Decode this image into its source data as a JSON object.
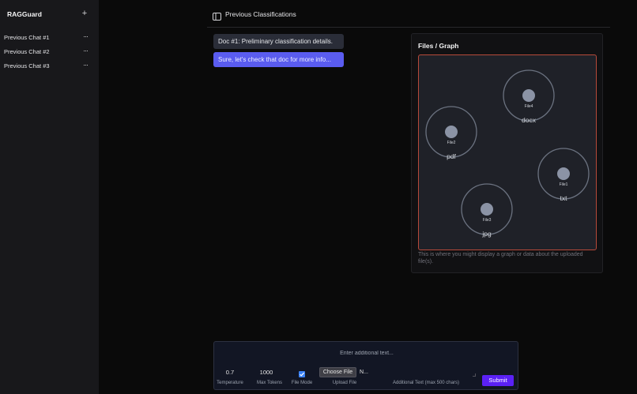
{
  "sidebar": {
    "brand": "RAGGuard",
    "new_chat_label": "+",
    "chats": [
      {
        "label": "Previous Chat #1",
        "menu": "···"
      },
      {
        "label": "Previous Chat #2",
        "menu": "···"
      },
      {
        "label": "Previous Chat #3",
        "menu": "···"
      }
    ]
  },
  "header": {
    "title": "Previous Classifications",
    "icon": "sidebar-panel-icon"
  },
  "messages": [
    {
      "text": "Doc #1: Preliminary classification details."
    },
    {
      "text": "Sure, let's check that doc for more info..."
    }
  ],
  "files_panel": {
    "title": "Files / Graph",
    "caption": "This is where you might display a graph or data about the uploaded file(s).",
    "nodes": [
      {
        "name": "File4",
        "type": "docx"
      },
      {
        "name": "File2",
        "type": "pdf"
      },
      {
        "name": "File1",
        "type": "txt"
      },
      {
        "name": "File3",
        "type": "jpg"
      }
    ]
  },
  "composer": {
    "placeholder": "Enter additional text...",
    "temperature": {
      "value": "0.7",
      "label": "Temperature"
    },
    "max_tokens": {
      "value": "1000",
      "label": "Max Tokens"
    },
    "file_mode": {
      "label": "File Mode",
      "checked": true
    },
    "upload": {
      "button": "Choose File",
      "file_name": "N...",
      "label": "Upload File"
    },
    "additional_text_label": "Additional Text (max 500 chars)",
    "submit": "Submit"
  },
  "colors": {
    "accent": "#5b21f5",
    "user_bubble": "#5a5cf0",
    "graph_border": "#b84a3a",
    "node_fill": "#8b93a5"
  }
}
